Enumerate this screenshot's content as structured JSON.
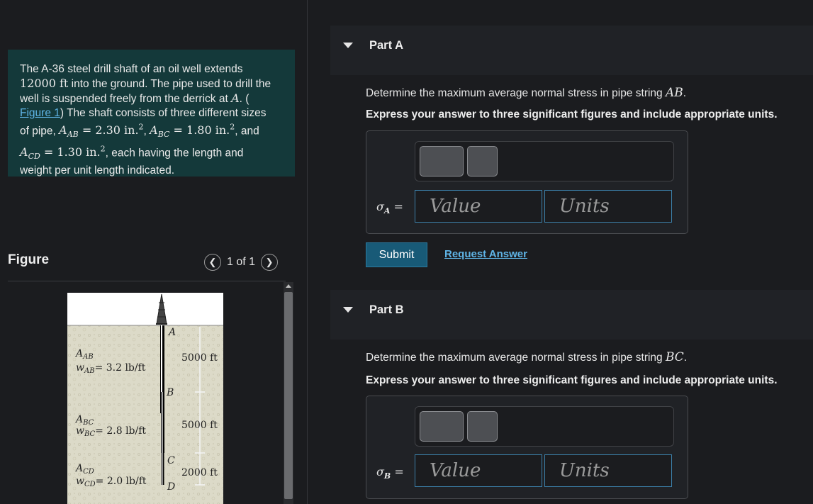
{
  "problem": {
    "lines": [
      "The A-36 steel drill shaft of an oil well extends",
      "12000 ft into the ground. The pipe used to drill the",
      "well is suspended freely from the derrick at A. (",
      "Figure 1) The shaft consists of three different sizes",
      "of pipe, A_AB = 2.30 in.^2, A_BC = 1.80 in.^2, and",
      "A_CD = 1.30 in.^2, each having the length and",
      "weight per unit length indicated."
    ],
    "figure_link": "Figure 1"
  },
  "figure": {
    "title": "Figure",
    "pager": "1 of 1",
    "labels": {
      "A": "A",
      "B": "B",
      "C": "C",
      "D": "D",
      "aab": "A",
      "aab_sub": "AB",
      "wab": "w",
      "wab_sub": "AB",
      "wab_val": "= 3.2 lb/ft",
      "abc": "A",
      "abc_sub": "BC",
      "wbc": "w",
      "wbc_sub": "BC",
      "wbc_val": "= 2.8 lb/ft",
      "acd": "A",
      "acd_sub": "CD",
      "wcd": "w",
      "wcd_sub": "CD",
      "wcd_val": "= 2.0 lb/ft",
      "len1": "5000 ft",
      "len2": "5000 ft",
      "len3": "2000 ft"
    }
  },
  "partA": {
    "title": "Part A",
    "question_prefix": "Determine the maximum average normal stress in pipe string ",
    "question_var": "AB",
    "question_suffix": ".",
    "instruction": "Express your answer to three significant figures and include appropriate units.",
    "var": "σ",
    "var_sub": "A",
    "eq": " =",
    "value_placeholder": "Value",
    "units_placeholder": "Units",
    "submit": "Submit",
    "request": "Request Answer"
  },
  "partB": {
    "title": "Part B",
    "question_prefix": "Determine the maximum average normal stress in pipe string ",
    "question_var": "BC",
    "question_suffix": ".",
    "instruction": "Express your answer to three significant figures and include appropriate units.",
    "var": "σ",
    "var_sub": "B",
    "eq": " =",
    "value_placeholder": "Value",
    "units_placeholder": "Units"
  },
  "colors": {
    "problem_bg": "#14393a",
    "link": "#5fb4e6",
    "submit_bg": "#185a77",
    "field_border": "#3b7ea7"
  }
}
